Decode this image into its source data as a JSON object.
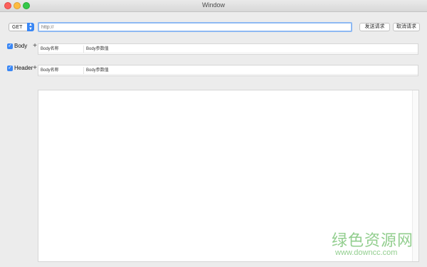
{
  "window": {
    "title": "Window"
  },
  "request": {
    "method": "GET",
    "url_placeholder": "http://",
    "send_label": "发送请求",
    "cancel_label": "取消请求"
  },
  "body_section": {
    "checked": true,
    "label": "Body",
    "columns": [
      "Body名称",
      "Body参数值"
    ]
  },
  "header_section": {
    "checked": true,
    "label": "Header",
    "columns": [
      "Body名称",
      "Body参数值"
    ]
  },
  "watermark": {
    "text": "绿色资源网",
    "url": "www.downcc.com"
  },
  "colors": {
    "accent": "#3a87f5",
    "focus_ring": "#8eb9f3",
    "watermark": "#7fc67b"
  },
  "icons": {
    "method_arrow": "updown-chevron-icon",
    "checkbox": "checkmark-icon",
    "add": "plus-icon"
  }
}
